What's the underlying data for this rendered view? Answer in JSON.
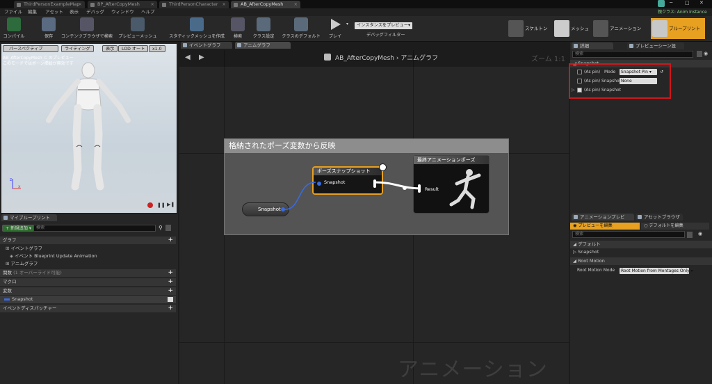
{
  "doc_tabs": [
    "ThirdPersonExampleMap",
    "BP_AfterCopyMesh",
    "ThirdPersonCharacter",
    "AB_AfterCopyMesh"
  ],
  "parent_class": "親クラス: Anim Instance",
  "menu": [
    "ファイル",
    "編集",
    "アセット",
    "表示",
    "デバッグ",
    "ウィンドウ",
    "ヘルプ"
  ],
  "toolbar": {
    "compile": "コンパイル",
    "save": "保存",
    "browse": "コンテンツブラウザで検索",
    "preview_mesh": "プレビューメッシュ",
    "static_mesh": "スタティックメッシュを作成",
    "search": "検索",
    "class_settings": "クラス設定",
    "class_defaults": "クラスのデフォルト",
    "play": "プレイ",
    "preview_instance": "インスタンスをプレビュー▾",
    "debug_filter": "デバッグフィルター"
  },
  "modes": [
    "スケルトン",
    "メッシュ",
    "アニメーション",
    "ブループリント"
  ],
  "viewport": {
    "perspective": "パースペクティブ",
    "lighting": "ライティング",
    "show": "表示",
    "lod": "LOD オート",
    "speed": "x1.0",
    "info1": "AB_AfterCopyMesh_C のプレビュー",
    "info2": "このモードではボーン挿絵が無効です"
  },
  "my_blueprint": {
    "tab": "マイブループリント",
    "add": "+ 新規追加 ▾",
    "search": "検索",
    "graphs": "グラフ",
    "event_graph": "イベントグラフ",
    "event_item": "イベント Blueprint Update Animation",
    "anim_graph": "アニムグラフ",
    "functions": "関数",
    "functions_note": "(1 オーバーライド可能)",
    "macros": "マクロ",
    "variables": "変数",
    "var_snapshot": "Snapshot",
    "dispatchers": "イベントディスパッチャー"
  },
  "graph": {
    "tab1": "イベントグラフ",
    "tab2": "アニムグラフ",
    "breadcrumb1": "AB_AfterCopyMesh",
    "breadcrumb_sep": "›",
    "breadcrumb2": "アニムグラフ",
    "zoom": "ズーム 1:1",
    "comment": "格納されたポーズ変数から反映",
    "pose_node_title": "ポーズスナップショット",
    "pose_node_pin": "Snapshot",
    "final_node_title": "最終アニメーションポーズ",
    "final_node_pin": "Result",
    "var_node": "Snapshot",
    "watermark": "アニメーション"
  },
  "details": {
    "tab1": "詳細",
    "tab2": "プレビューシーン設",
    "search": "検索",
    "section": "Snapshot",
    "row1_label": "(As pin)",
    "row1_mode": "Mode",
    "row1_value": "Snapshot Pin ▾",
    "row2_label": "(As pin) Snapshot",
    "row2_value": "None",
    "row3_label": "(As pin) Snapshot",
    "highlight_color": "#d0161b"
  },
  "anim_preview": {
    "tab1": "アニメーションプレビ",
    "tab2": "アセットブラウザ",
    "edit_preview": "プレビューを編集",
    "edit_defaults": "デフォルトを編集",
    "search": "検索",
    "defaults": "デフォルト",
    "snapshot": "Snapshot",
    "root_motion": "Root Motion",
    "root_mode_label": "Root Motion Mode",
    "root_mode_value": "Root Motion from Montages Only ▾"
  }
}
